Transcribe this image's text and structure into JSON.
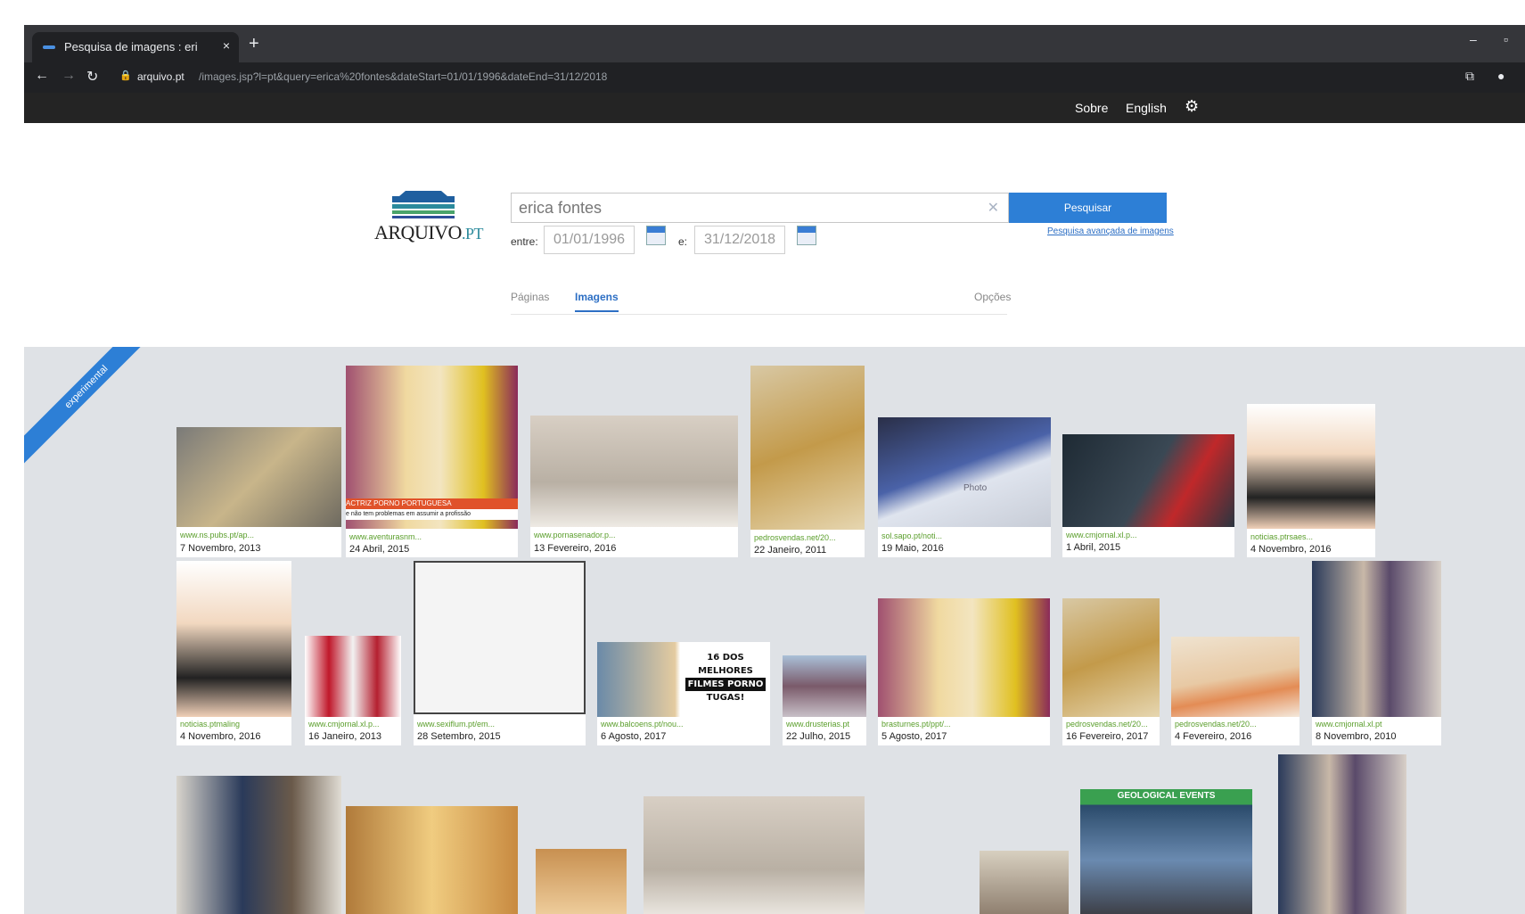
{
  "browser": {
    "tab_title": "Pesquisa de imagens : eri",
    "tab_close": "×",
    "new_tab": "+",
    "url_host": "arquivo.pt",
    "url_path": "/images.jsp?l=pt&query=erica%20fontes&dateStart=01/01/1996&dateEnd=31/12/2018",
    "minimize": "–",
    "maximize": "▫"
  },
  "sitebar": {
    "about": "Sobre",
    "language": "English"
  },
  "logo": {
    "main": "ARQUIVO",
    "suffix": ".PT"
  },
  "search": {
    "query": "erica fontes",
    "button": "Pesquisar",
    "advanced": "Pesquisa avançada de imagens",
    "from_label": "entre:",
    "from": "01/01/1996",
    "to_label": "e:",
    "to": "31/12/2018"
  },
  "tabs": {
    "pages": "Páginas",
    "images": "Imagens",
    "options": "Opções"
  },
  "ribbon": "experimental",
  "results": [
    {
      "src": "www.ns.pubs.pt/ap...",
      "date": "7 Novembro, 2013"
    },
    {
      "src": "www.aventurasnm...",
      "date": "24 Abril, 2015"
    },
    {
      "src": "www.pornasenador.p...",
      "date": "13 Fevereiro, 2016"
    },
    {
      "src": "pedrosvendas.net/20...",
      "date": "22 Janeiro, 2011"
    },
    {
      "src": "sol.sapo.pt/noti...",
      "date": "19 Maio, 2016"
    },
    {
      "src": "www.cmjornal.xl.p...",
      "date": "1 Abril, 2015"
    },
    {
      "src": "noticias.ptrsaes...",
      "date": "4 Novembro, 2016"
    },
    {
      "src": "noticias.ptmaling",
      "date": "4 Novembro, 2016"
    },
    {
      "src": "www.cmjornal.xl.p...",
      "date": "16 Janeiro, 2013"
    },
    {
      "src": "www.sexiflum.pt/em...",
      "date": "28 Setembro, 2015"
    },
    {
      "src": "www.balcoens.pt/nou...",
      "date": "6 Agosto, 2017"
    },
    {
      "src": "www.drusterias.pt",
      "date": "22 Julho, 2015"
    },
    {
      "src": "brasturnes.pt/ppt/...",
      "date": "5 Agosto, 2017"
    },
    {
      "src": "pedrosvendas.net/20...",
      "date": "16 Fevereiro, 2017"
    },
    {
      "src": "pedrosvendas.net/20...",
      "date": "4 Fevereiro, 2016"
    },
    {
      "src": "www.cmjornal.xl.pt",
      "date": "8 Novembro, 2010"
    }
  ],
  "thumb_texts": {
    "porn_banner": "ACTRIZ PORNO PORTUGUESA",
    "porn_caption": "e não tem problemas em assumir a profissão",
    "list_line1": "16 DOS",
    "list_line2": "MELHORES",
    "list_line3": "FILMES PORNO",
    "list_line4": "TUGAS!",
    "facebook_label": "Photo",
    "geo": "GEOLOGICAL EVENTS"
  },
  "colors": {
    "accent": "#2d7fd6",
    "source_link": "#5a9e2b",
    "results_bg": "#dfe2e6"
  }
}
